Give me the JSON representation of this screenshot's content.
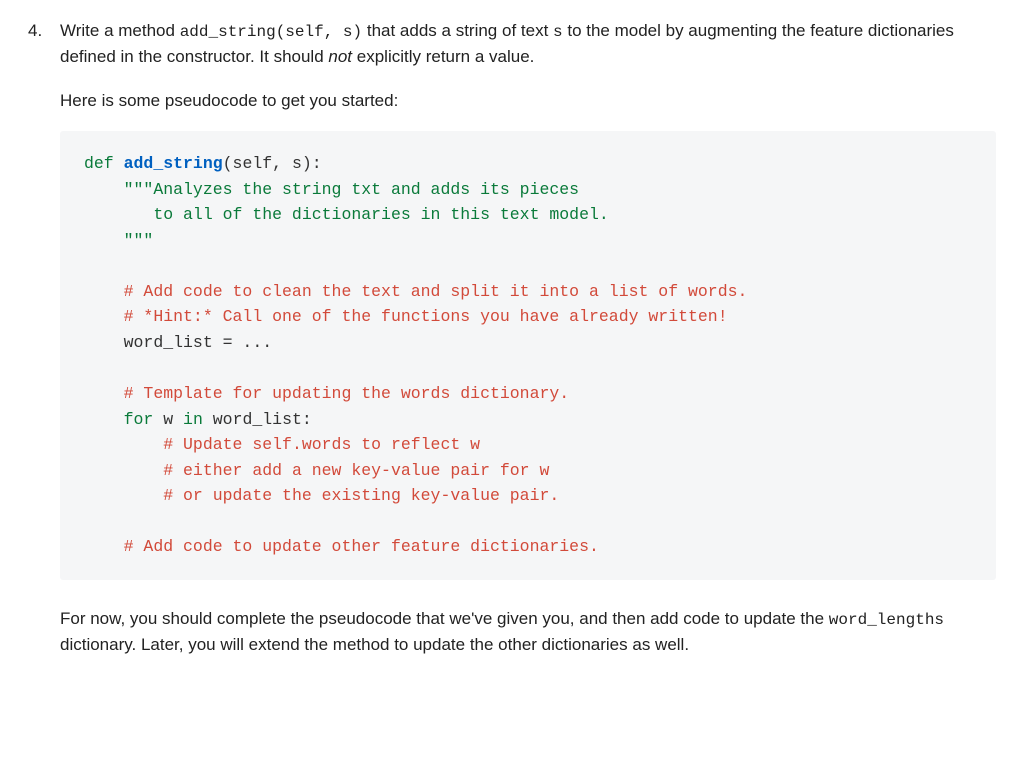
{
  "question": {
    "number": "4.",
    "intro_p1_a": "Write a method ",
    "intro_p1_code": "add_string(self, s)",
    "intro_p1_b": " that adds a string of text ",
    "intro_p1_code2": "s",
    "intro_p1_c": " to the model by augmenting the feature dictionaries defined in the constructor. It should ",
    "intro_p1_not": "not",
    "intro_p1_d": " explicitly return a value.",
    "intro_p2": "Here is some pseudocode to get you started:"
  },
  "code": {
    "def": "def",
    "fn": "add_string",
    "sig_rest": "(self, s):",
    "doc1": "\"\"\"Analyzes the string txt and adds its pieces",
    "doc2": "   to all of the dictionaries in this text model.",
    "doc3": "\"\"\"",
    "c1": "# Add code to clean the text and split it into a list of words.",
    "c2": "# *Hint:* Call one of the functions you have already written!",
    "wl": "word_list = ...",
    "c3": "# Template for updating the words dictionary.",
    "for": "for",
    "w": " w ",
    "in": "in",
    "wlv": " word_list:",
    "c4": "# Update self.words to reflect w",
    "c5": "# either add a new key-value pair for w",
    "c6": "# or update the existing key-value pair.",
    "c7": "# Add code to update other feature dictionaries."
  },
  "outro": {
    "a": "For now, you should complete the pseudocode that we've given you, and then add code to update the ",
    "code": "word_lengths",
    "b": " dictionary. Later, you will extend the method to update the other dictionaries as well."
  }
}
